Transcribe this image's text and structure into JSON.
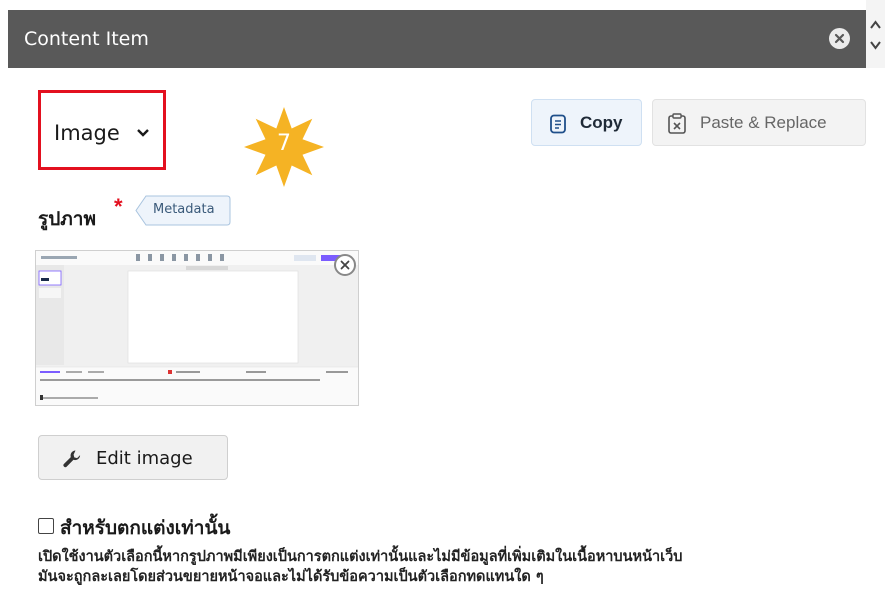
{
  "header": {
    "title": "Content Item"
  },
  "content_type": {
    "selected": "Image"
  },
  "step_badge": {
    "number": "7",
    "color": "#f5b324"
  },
  "toolbar": {
    "copy_label": "Copy",
    "paste_label": "Paste & Replace"
  },
  "image_field": {
    "label": "รูปภาพ",
    "required_mark": "*",
    "metadata_label": "Metadata"
  },
  "edit_button": {
    "label": "Edit image"
  },
  "decorative_option": {
    "label": "สำหรับตกแต่งเท่านั้น",
    "checked": false,
    "help_lines": [
      "เปิดใช้งานตัวเลือกนี้หากรูปภาพมีเพียงเป็นการตกแต่งเท่านั้นและไม่มีข้อมูลที่เพิ่มเติมในเนื้อหาบนหน้าเว็บ",
      "มันจะถูกละเลยโดยส่วนขยายหน้าจอและไม่ได้รับข้อความเป็นตัวเลือกทดแทนใด ๆ"
    ]
  },
  "colors": {
    "header_bg": "#595959",
    "highlight_border": "#e3101f",
    "copy_bg": "#eef4fb"
  }
}
